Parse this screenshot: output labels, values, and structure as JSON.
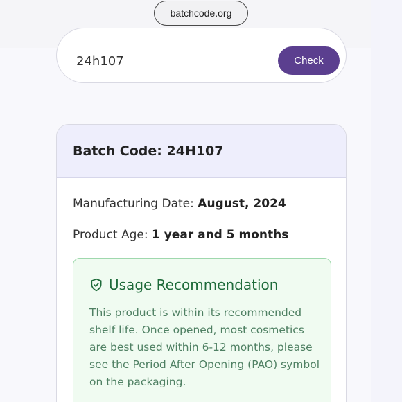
{
  "browser": {
    "url": "batchcode.org"
  },
  "search": {
    "value": "24h107",
    "button_label": "Check"
  },
  "result": {
    "title": "Batch Code: 24H107",
    "manufacturing_label": "Manufacturing Date:",
    "manufacturing_value": "August, 2024",
    "age_label": "Product Age:",
    "age_value": "1 year and 5 months",
    "recommendation": {
      "icon": "shield-check-icon",
      "heading": "Usage Recommendation",
      "text": "This product is within its recommended shelf life. Once opened, most cosmetics are best used within 6-12 months, please see the Period After Opening (PAO) symbol on the packaging."
    }
  },
  "colors": {
    "accent": "#5b3f8f",
    "header_bg": "#eeeefc",
    "success_bg": "#f0fbf1",
    "success_text": "#1e6b3a"
  }
}
